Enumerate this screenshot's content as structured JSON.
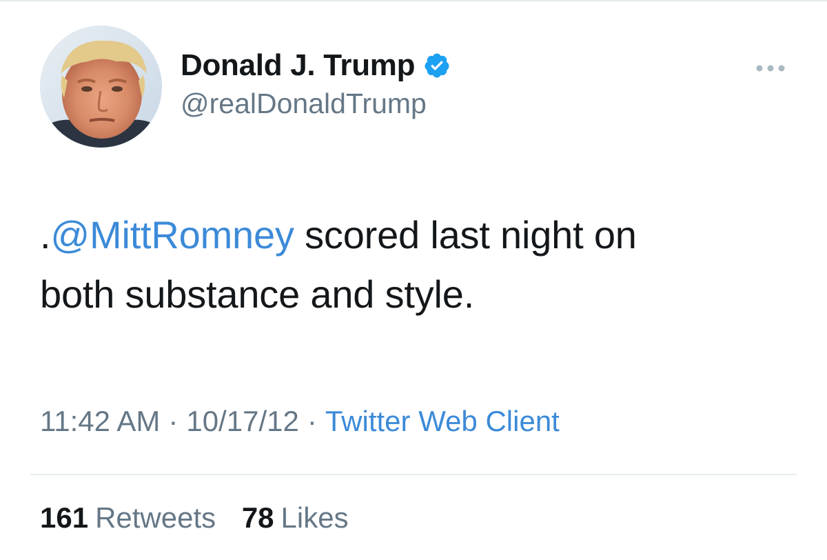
{
  "tweet": {
    "author": {
      "display_name": "Donald J. Trump",
      "handle": "@realDonaldTrump",
      "verified": true,
      "avatar_icon": "profile-photo"
    },
    "text": {
      "prefix": ".",
      "mention": "@MittRomney",
      "body_line1": " scored last night on",
      "body_line2": "both substance and style."
    },
    "meta": {
      "time": "11:42 AM",
      "separator": "·",
      "date": "10/17/12",
      "source": "Twitter Web Client"
    },
    "stats": {
      "retweets_count": "161",
      "retweets_label": "Retweets",
      "likes_count": "78",
      "likes_label": "Likes"
    }
  },
  "colors": {
    "link": "#3c8ad8",
    "secondary_text": "#657786",
    "primary_text": "#14171a",
    "verified_badge": "#1da1f2",
    "divider": "#e6ecf0"
  },
  "icons": {
    "verified": "verified-badge-icon",
    "more": "more-options-icon"
  }
}
